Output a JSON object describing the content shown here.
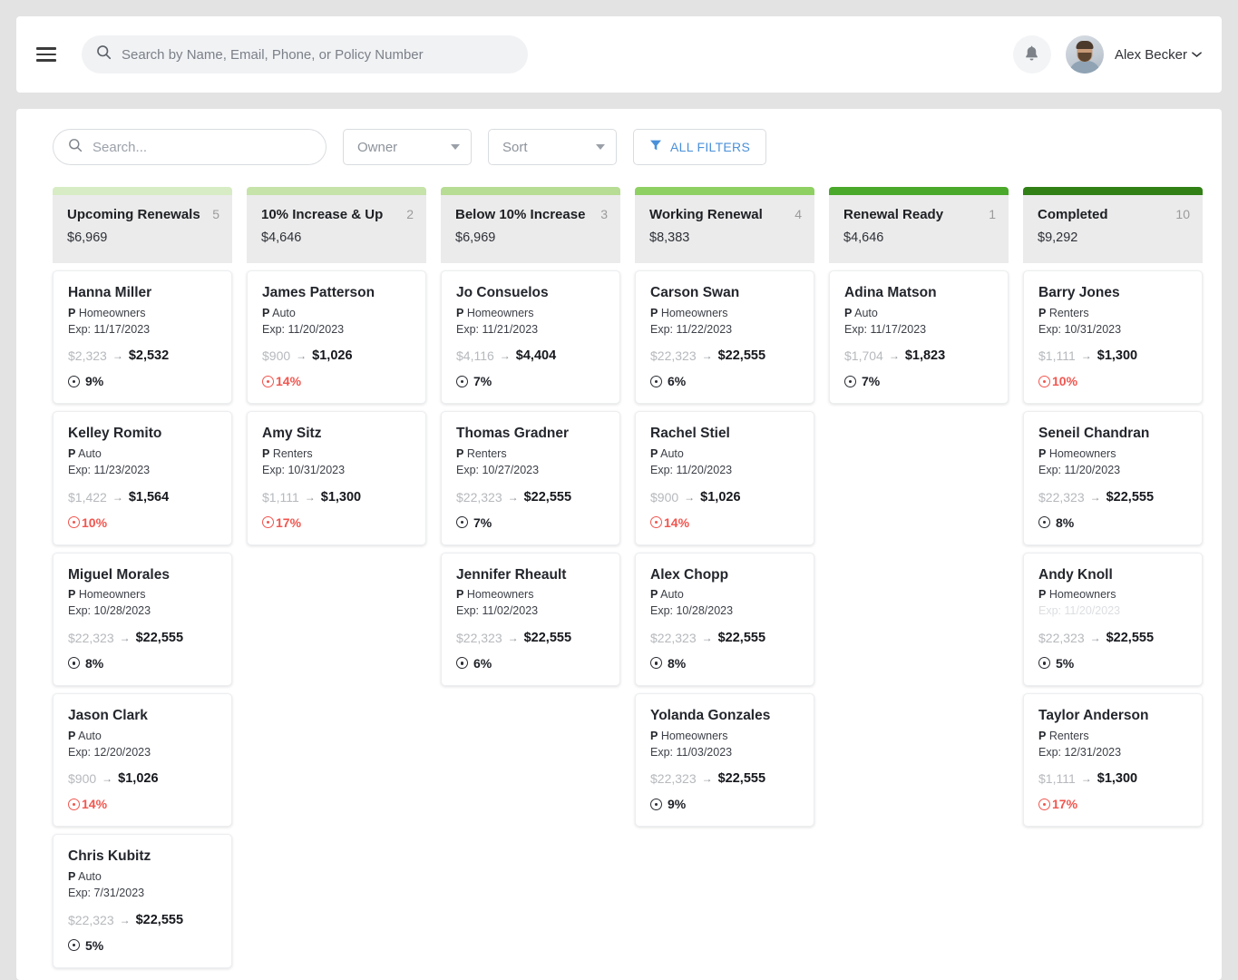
{
  "header": {
    "menu_icon": "hamburger-icon",
    "search": {
      "icon": "search-icon",
      "value": "",
      "placeholder": "Search by Name, Email, Phone, or Policy Number"
    },
    "notifications_icon": "bell-icon",
    "user": {
      "name": "Alex Becker",
      "avatar": "user-avatar-photo",
      "chevron": "chevron-down-icon"
    }
  },
  "toolbar": {
    "search": {
      "icon": "search-icon",
      "value": "",
      "placeholder": "Search..."
    },
    "owner_select": {
      "label": "Owner",
      "caret": "chevron-down-icon"
    },
    "sort_select": {
      "label": "Sort",
      "caret": "chevron-down-icon"
    },
    "all_filters": {
      "label": "ALL FILTERS",
      "icon": "funnel-icon",
      "color": "#4a90d9"
    }
  },
  "board": {
    "columns": [
      {
        "title": "Upcoming Renewals",
        "count": "5",
        "amount": "$6,969",
        "accent": "#d7ecc4",
        "cards": [
          {
            "name": "Hanna Miller",
            "badge": "P",
            "policy_type": "Homeowners",
            "exp": "Exp: 11/17/2023",
            "exp_faded": false,
            "old_price": "$2,323",
            "arrow": "→",
            "new_price": "$2,532",
            "pct": "9%",
            "pct_red": false
          },
          {
            "name": "Kelley Romito",
            "badge": "P",
            "policy_type": "Auto",
            "exp": "Exp: 11/23/2023",
            "exp_faded": false,
            "old_price": "$1,422",
            "arrow": "→",
            "new_price": "$1,564",
            "pct": "10%",
            "pct_red": true
          },
          {
            "name": "Miguel Morales",
            "badge": "P",
            "policy_type": "Homeowners",
            "exp": "Exp: 10/28/2023",
            "exp_faded": false,
            "old_price": "$22,323",
            "arrow": "→",
            "new_price": "$22,555",
            "pct": "8%",
            "pct_red": false
          },
          {
            "name": "Jason Clark",
            "badge": "P",
            "policy_type": "Auto",
            "exp": "Exp: 12/20/2023",
            "exp_faded": false,
            "old_price": "$900",
            "arrow": "→",
            "new_price": "$1,026",
            "pct": "14%",
            "pct_red": true
          },
          {
            "name": "Chris Kubitz",
            "badge": "P",
            "policy_type": "Auto",
            "exp": "Exp: 7/31/2023",
            "exp_faded": false,
            "old_price": "$22,323",
            "arrow": "→",
            "new_price": "$22,555",
            "pct": "5%",
            "pct_red": false
          }
        ]
      },
      {
        "title": "10% Increase & Up",
        "count": "2",
        "amount": "$4,646",
        "accent": "#c6e3a9",
        "cards": [
          {
            "name": "James Patterson",
            "badge": "P",
            "policy_type": "Auto",
            "exp": "Exp: 11/20/2023",
            "exp_faded": false,
            "old_price": "$900",
            "arrow": "→",
            "new_price": "$1,026",
            "pct": "14%",
            "pct_red": true
          },
          {
            "name": "Amy Sitz",
            "badge": "P",
            "policy_type": "Renters",
            "exp": "Exp: 10/31/2023",
            "exp_faded": false,
            "old_price": "$1,111",
            "arrow": "→",
            "new_price": "$1,300",
            "pct": "17%",
            "pct_red": true
          }
        ]
      },
      {
        "title": "Below 10% Increase",
        "count": "3",
        "amount": "$6,969",
        "accent": "#b7dc94",
        "cards": [
          {
            "name": "Jo Consuelos",
            "badge": "P",
            "policy_type": "Homeowners",
            "exp": "Exp: 11/21/2023",
            "exp_faded": false,
            "old_price": "$4,116",
            "arrow": "→",
            "new_price": "$4,404",
            "pct": "7%",
            "pct_red": false
          },
          {
            "name": "Thomas Gradner",
            "badge": "P",
            "policy_type": "Renters",
            "exp": "Exp: 10/27/2023",
            "exp_faded": false,
            "old_price": "$22,323",
            "arrow": "→",
            "new_price": "$22,555",
            "pct": "7%",
            "pct_red": false
          },
          {
            "name": "Jennifer Rheault",
            "badge": "P",
            "policy_type": "Homeowners",
            "exp": "Exp: 11/02/2023",
            "exp_faded": false,
            "old_price": "$22,323",
            "arrow": "→",
            "new_price": "$22,555",
            "pct": "6%",
            "pct_red": false
          }
        ]
      },
      {
        "title": "Working Renewal",
        "count": "4",
        "amount": "$8,383",
        "accent": "#8fd063",
        "cards": [
          {
            "name": "Carson Swan",
            "badge": "P",
            "policy_type": "Homeowners",
            "exp": "Exp: 11/22/2023",
            "exp_faded": false,
            "old_price": "$22,323",
            "arrow": "→",
            "new_price": "$22,555",
            "pct": "6%",
            "pct_red": false
          },
          {
            "name": "Rachel Stiel",
            "badge": "P",
            "policy_type": "Auto",
            "exp": "Exp: 11/20/2023",
            "exp_faded": false,
            "old_price": "$900",
            "arrow": "→",
            "new_price": "$1,026",
            "pct": "14%",
            "pct_red": true
          },
          {
            "name": "Alex Chopp",
            "badge": "P",
            "policy_type": "Auto",
            "exp": "Exp: 10/28/2023",
            "exp_faded": false,
            "old_price": "$22,323",
            "arrow": "→",
            "new_price": "$22,555",
            "pct": "8%",
            "pct_red": false
          },
          {
            "name": "Yolanda Gonzales",
            "badge": "P",
            "policy_type": "Homeowners",
            "exp": "Exp: 11/03/2023",
            "exp_faded": false,
            "old_price": "$22,323",
            "arrow": "→",
            "new_price": "$22,555",
            "pct": "9%",
            "pct_red": false
          }
        ]
      },
      {
        "title": "Renewal Ready",
        "count": "1",
        "amount": "$4,646",
        "accent": "#4aa82a",
        "cards": [
          {
            "name": "Adina Matson",
            "badge": "P",
            "policy_type": "Auto",
            "exp": "Exp: 11/17/2023",
            "exp_faded": false,
            "old_price": "$1,704",
            "arrow": "→",
            "new_price": "$1,823",
            "pct": "7%",
            "pct_red": false
          }
        ]
      },
      {
        "title": "Completed",
        "count": "10",
        "amount": "$9,292",
        "accent": "#318016",
        "cards": [
          {
            "name": "Barry Jones",
            "badge": "P",
            "policy_type": "Renters",
            "exp": "Exp: 10/31/2023",
            "exp_faded": false,
            "old_price": "$1,111",
            "arrow": "→",
            "new_price": "$1,300",
            "pct": "10%",
            "pct_red": true
          },
          {
            "name": "Seneil Chandran",
            "badge": "P",
            "policy_type": "Homeowners",
            "exp": "Exp: 11/20/2023",
            "exp_faded": false,
            "old_price": "$22,323",
            "arrow": "→",
            "new_price": "$22,555",
            "pct": "8%",
            "pct_red": false
          },
          {
            "name": "Andy Knoll",
            "badge": "P",
            "policy_type": "Homeowners",
            "exp": "Exp: 11/20/2023",
            "exp_faded": true,
            "old_price": "$22,323",
            "arrow": "→",
            "new_price": "$22,555",
            "pct": "5%",
            "pct_red": false
          },
          {
            "name": "Taylor Anderson",
            "badge": "P",
            "policy_type": "Renters",
            "exp": "Exp: 12/31/2023",
            "exp_faded": false,
            "old_price": "$1,111",
            "arrow": "→",
            "new_price": "$1,300",
            "pct": "17%",
            "pct_red": true
          }
        ]
      }
    ]
  }
}
